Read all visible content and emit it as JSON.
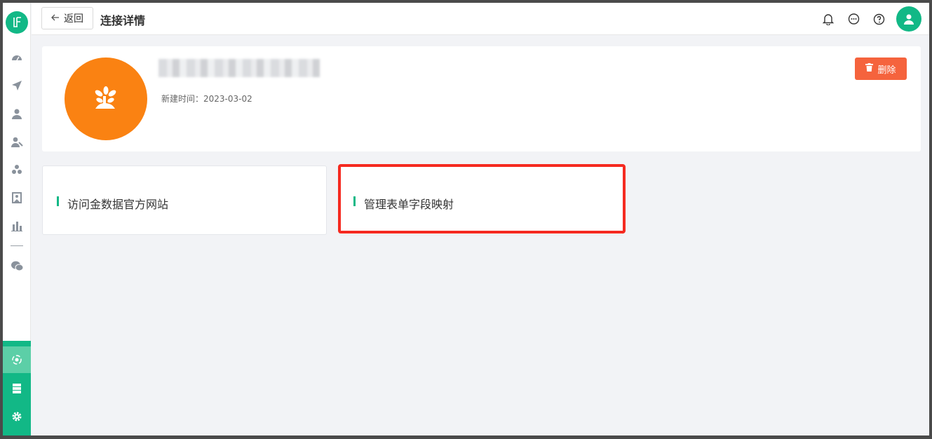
{
  "sidebar": {
    "logo": "lf-logo-icon",
    "items": [
      {
        "icon": "dashboard-icon"
      },
      {
        "icon": "send-icon"
      },
      {
        "icon": "user-icon"
      },
      {
        "icon": "users-icon"
      },
      {
        "icon": "groups-icon"
      },
      {
        "icon": "badge-icon"
      },
      {
        "icon": "bar-chart-icon"
      },
      {
        "icon": "wechat-icon"
      }
    ],
    "bottom_items": [
      {
        "icon": "connection-icon"
      },
      {
        "icon": "database-icon"
      },
      {
        "icon": "settings-icon"
      }
    ]
  },
  "header": {
    "back_label": "返回",
    "title": "连接详情",
    "icons": [
      "bell-icon",
      "message-icon",
      "help-icon",
      "user-avatar-icon"
    ]
  },
  "info": {
    "created_text": "新建时间：2023-03-02",
    "delete_label": "删除"
  },
  "actions": [
    {
      "label": "访问金数据官方网站"
    },
    {
      "label": "管理表单字段映射"
    }
  ],
  "colors": {
    "accent": "#12b886",
    "avatar": "#fa8212",
    "delete": "#f5633d",
    "highlight": "#f52a20"
  }
}
